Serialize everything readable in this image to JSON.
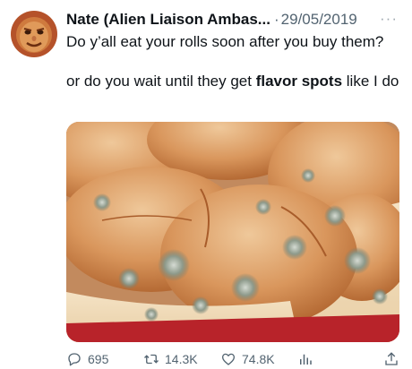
{
  "tweet": {
    "author": "Nate (Alien Liaison Ambas...",
    "separator": "·",
    "date": "29/05/2019",
    "more": "···",
    "line1": "Do y’all eat your rolls soon after you buy them?",
    "line2_prefix": "or do you wait until they get ",
    "line2_bold": "flavor spots",
    "line2_suffix": " like I do"
  },
  "actions": {
    "replies": "695",
    "retweets": "14.3K",
    "likes": "74.8K"
  },
  "icons": [
    "avatar",
    "more-icon",
    "reply-icon",
    "retweet-icon",
    "like-icon",
    "views-icon",
    "share-icon"
  ],
  "colors": {
    "text": "#0f1419",
    "muted": "#536471",
    "mold": "#7f8f7d"
  }
}
